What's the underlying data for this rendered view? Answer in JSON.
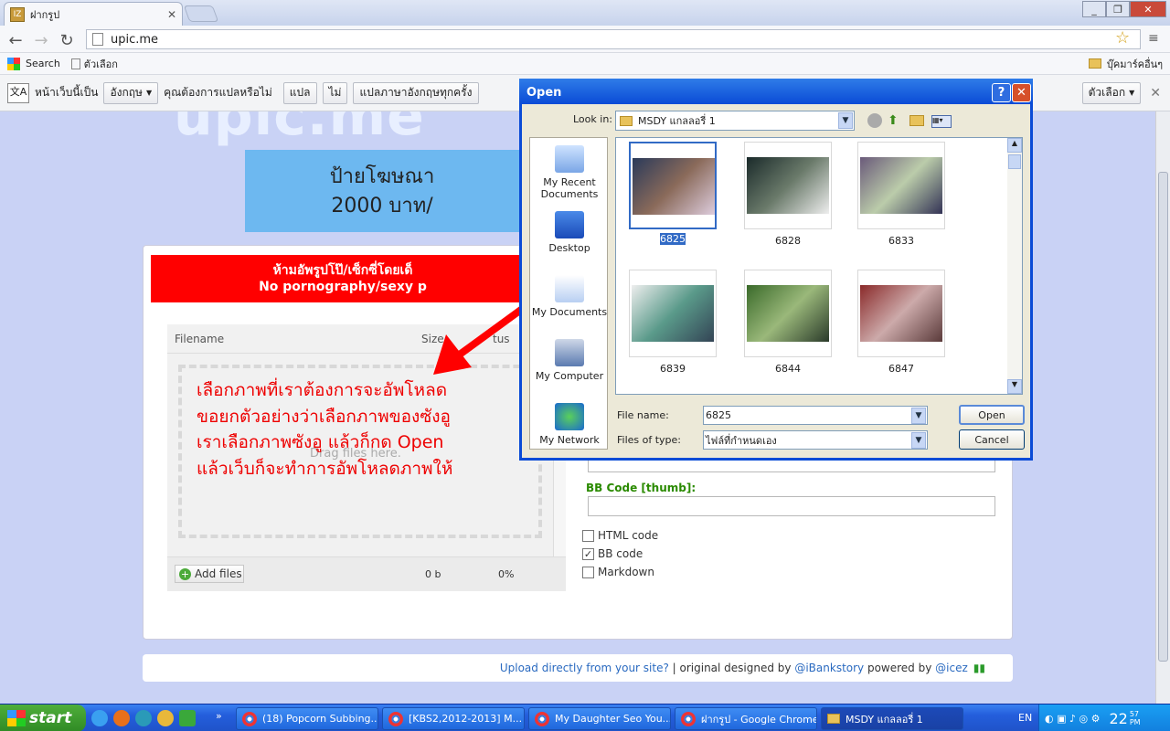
{
  "browser": {
    "tab_title": "ฝากรูป",
    "tab_favicon": "IZ",
    "url": "upic.me",
    "bookmarks": {
      "search": "Search",
      "item2": "ตัวเลือก",
      "other": "บุ๊คมาร์คอื่นๆ"
    },
    "translate": {
      "prefix": "หน้าเว็บนี้เป็น",
      "language": "อังกฤษ",
      "question": "คุณต้องการแปลหรือไม่",
      "translate_btn": "แปล",
      "no_btn": "ไม่",
      "always_btn": "แปลภาษาอังกฤษทุกครั้ง",
      "options_btn": "ตัวเลือก"
    }
  },
  "page": {
    "logo": "upic.me",
    "ad_line1": "ป้ายโฆษณา",
    "ad_line2": "2000 บาท/",
    "banner_line1": "ห้ามอัพรูปโป๊/เซ็กซี่โดยเด็",
    "banner_line2": "No pornography/sexy p",
    "uploader": {
      "col_filename": "Filename",
      "col_size": "Size",
      "col_status": "tus",
      "drop_text": "Drag files here.",
      "add_files": "Add files",
      "total_size": "0 b",
      "total_percent": "0%"
    },
    "instructions": [
      "เลือกภาพที่เราต้องการจะอัพโหลด",
      "ขอยกตัวอย่างว่าเลือกภาพของซังอู",
      "เราเลือกภาพซังอู แล้วก็กด Open",
      "แล้วเว็บก็จะทำการอัพโหลดภาพให้"
    ],
    "bbcode_thumb_label": "BB Code [thumb]:",
    "options": [
      {
        "label": "HTML code",
        "checked": false
      },
      {
        "label": "BB code",
        "checked": true
      },
      {
        "label": "Markdown",
        "checked": false
      }
    ],
    "footer": {
      "upload_link": "Upload directly from your site?",
      "sep": " | original designed by ",
      "designer": "@iBankstory",
      "powered": " powered by ",
      "author": "@icez"
    }
  },
  "dialog": {
    "title": "Open",
    "look_in_label": "Look in:",
    "look_in_value": "MSDY แกลลอรี่ 1",
    "places": [
      "My Recent Documents",
      "Desktop",
      "My Documents",
      "My Computer",
      "My Network"
    ],
    "files": [
      "6825",
      "6828",
      "6833",
      "6839",
      "6844",
      "6847"
    ],
    "file_name_label": "File name:",
    "file_name_value": "6825",
    "file_type_label": "Files of type:",
    "file_type_value": "ไฟล์ที่กำหนดเอง",
    "open_btn": "Open",
    "cancel_btn": "Cancel"
  },
  "taskbar": {
    "start": "start",
    "tasks": [
      "(18) Popcorn Subbing...",
      "[KBS2,2012-2013] M...",
      "My Daughter Seo You...",
      "ฝากรูป - Google Chrome",
      "MSDY แกลลอรี่ 1"
    ],
    "lang": "EN",
    "clock_hour": "22",
    "clock_min": "57",
    "clock_ampm": "PM"
  },
  "colors": {
    "accent": "#0a4bd6",
    "banner": "#ff0000",
    "instruction": "#ee0000"
  }
}
